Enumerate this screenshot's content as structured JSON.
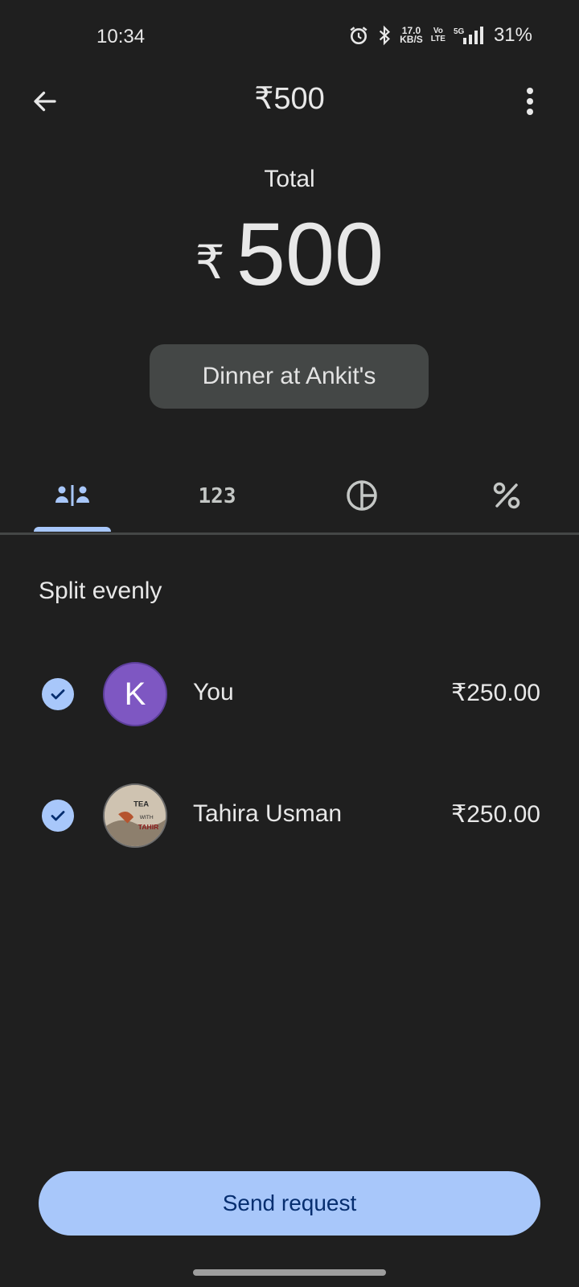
{
  "status_bar": {
    "time": "10:34",
    "speed_value": "17.0",
    "speed_unit": "KB/S",
    "volte_top": "Vo",
    "volte_bottom": "LTE",
    "network": "5G",
    "battery": "31%"
  },
  "app_bar": {
    "title": "₹500"
  },
  "total": {
    "label": "Total",
    "currency": "₹",
    "amount": "500"
  },
  "note": "Dinner at Ankit's",
  "tabs": [
    {
      "name": "split-evenly",
      "icon": "people-split-icon",
      "active": true
    },
    {
      "name": "exact-amounts",
      "icon": "numbers-123-icon",
      "active": false
    },
    {
      "name": "by-shares",
      "icon": "pie-chart-icon",
      "active": false
    },
    {
      "name": "by-percentage",
      "icon": "percent-icon",
      "active": false
    }
  ],
  "tab_labels": {
    "exact_amounts": "123"
  },
  "section_title": "Split evenly",
  "participants": [
    {
      "name": "You",
      "avatar_letter": "K",
      "amount": "₹250.00",
      "checked": true
    },
    {
      "name": "Tahira Usman",
      "avatar_letter": "",
      "amount": "₹250.00",
      "checked": true
    }
  ],
  "avatar_photo_lettering": "TEA WITH TAHIR",
  "send_button": "Send request",
  "colors": {
    "background": "#1f1f1f",
    "accent": "#a8c7fa",
    "chip": "#444746",
    "avatar_you": "#7e57c2",
    "button_text": "#062e6f"
  }
}
